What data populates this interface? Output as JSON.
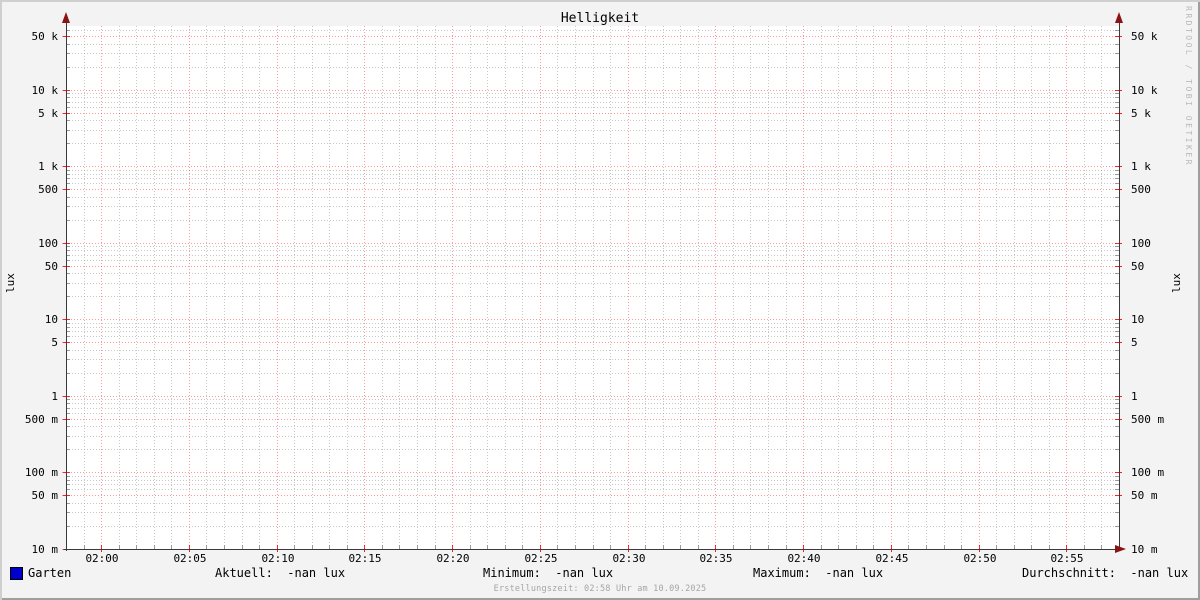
{
  "title": "Helligkeit",
  "watermark": "RRDTOOL / TOBI OETIKER",
  "footer": "Erstellungszeit: 02:58 Uhr am 10.09.2025",
  "axis": {
    "left_unit": "lux",
    "right_unit": "lux"
  },
  "legend": {
    "series": {
      "label": "Garten",
      "color": "#0000cc"
    },
    "stats": [
      {
        "label": "Aktuell",
        "value": "-nan lux",
        "text": "Aktuell:  -nan lux"
      },
      {
        "label": "Minimum",
        "value": "-nan lux",
        "text": "Minimum:  -nan lux"
      },
      {
        "label": "Maximum",
        "value": "-nan lux",
        "text": "Maximum:  -nan lux"
      },
      {
        "label": "Durchschnitt",
        "value": "-nan lux",
        "text": "Durchschnitt:  -nan lux"
      }
    ]
  },
  "colors": {
    "background": "#f3f3f3",
    "canvas": "#ffffff",
    "grid_major": "#ff0000",
    "grid_major_opacity": 0.4,
    "grid_minor": "#909090",
    "grid_minor_opacity": 0.5,
    "axis": "#3a3a3a",
    "arrow": "#8a1414",
    "border_light": "#cfcfcf",
    "border_dark": "#9e9e9e",
    "series_garten": "#0000cc"
  },
  "chart_data": {
    "type": "line",
    "title": "Helligkeit",
    "xlabel": "",
    "ylabel": "lux",
    "y_scale": "log10",
    "ylim": [
      0.01,
      68000
    ],
    "grid": true,
    "legend_position": "bottom",
    "x_tick_labels": [
      "02:00",
      "02:05",
      "02:10",
      "02:15",
      "02:20",
      "02:25",
      "02:30",
      "02:35",
      "02:40",
      "02:45",
      "02:50",
      "02:55"
    ],
    "x_tick_interval_minutes": 5,
    "x_minor_interval_minutes": 1,
    "x_range_minutes": [
      -2,
      58
    ],
    "y_major_ticks": [
      {
        "v": 50000,
        "label": "50 k"
      },
      {
        "v": 10000,
        "label": "10 k"
      },
      {
        "v": 5000,
        "label": "5 k"
      },
      {
        "v": 1000,
        "label": "1 k"
      },
      {
        "v": 500,
        "label": "500"
      },
      {
        "v": 100,
        "label": "100"
      },
      {
        "v": 50,
        "label": "50"
      },
      {
        "v": 10,
        "label": "10"
      },
      {
        "v": 5,
        "label": "5"
      },
      {
        "v": 1,
        "label": "1"
      },
      {
        "v": 0.5,
        "label": "500 m"
      },
      {
        "v": 0.1,
        "label": "100 m"
      },
      {
        "v": 0.05,
        "label": "50 m"
      },
      {
        "v": 0.01,
        "label": "10 m"
      }
    ],
    "y_minor_multipliers": [
      2,
      3,
      4,
      6,
      7,
      8,
      9
    ],
    "series": [
      {
        "name": "Garten",
        "color": "#0000cc",
        "values": []
      }
    ]
  }
}
